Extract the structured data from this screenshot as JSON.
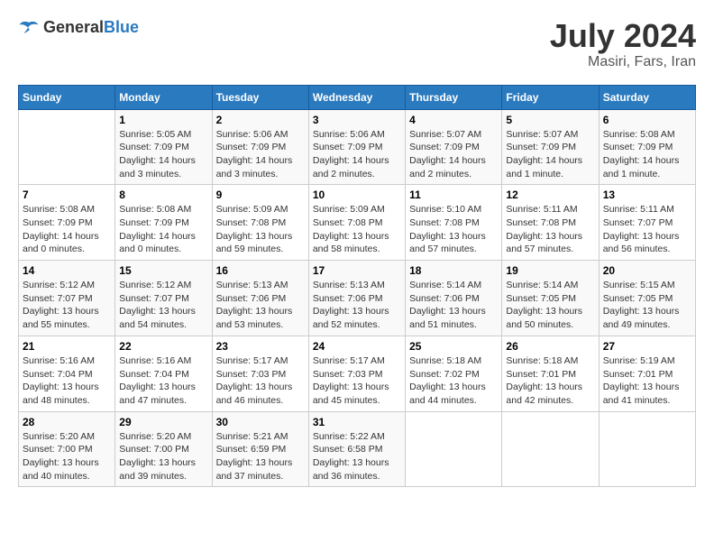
{
  "header": {
    "logo_general": "General",
    "logo_blue": "Blue",
    "main_title": "July 2024",
    "subtitle": "Masiri, Fars, Iran"
  },
  "calendar": {
    "days_of_week": [
      "Sunday",
      "Monday",
      "Tuesday",
      "Wednesday",
      "Thursday",
      "Friday",
      "Saturday"
    ],
    "weeks": [
      [
        {
          "date": "",
          "info": ""
        },
        {
          "date": "1",
          "info": "Sunrise: 5:05 AM\nSunset: 7:09 PM\nDaylight: 14 hours\nand 3 minutes."
        },
        {
          "date": "2",
          "info": "Sunrise: 5:06 AM\nSunset: 7:09 PM\nDaylight: 14 hours\nand 3 minutes."
        },
        {
          "date": "3",
          "info": "Sunrise: 5:06 AM\nSunset: 7:09 PM\nDaylight: 14 hours\nand 2 minutes."
        },
        {
          "date": "4",
          "info": "Sunrise: 5:07 AM\nSunset: 7:09 PM\nDaylight: 14 hours\nand 2 minutes."
        },
        {
          "date": "5",
          "info": "Sunrise: 5:07 AM\nSunset: 7:09 PM\nDaylight: 14 hours\nand 1 minute."
        },
        {
          "date": "6",
          "info": "Sunrise: 5:08 AM\nSunset: 7:09 PM\nDaylight: 14 hours\nand 1 minute."
        }
      ],
      [
        {
          "date": "7",
          "info": "Sunrise: 5:08 AM\nSunset: 7:09 PM\nDaylight: 14 hours\nand 0 minutes."
        },
        {
          "date": "8",
          "info": "Sunrise: 5:08 AM\nSunset: 7:09 PM\nDaylight: 14 hours\nand 0 minutes."
        },
        {
          "date": "9",
          "info": "Sunrise: 5:09 AM\nSunset: 7:08 PM\nDaylight: 13 hours\nand 59 minutes."
        },
        {
          "date": "10",
          "info": "Sunrise: 5:09 AM\nSunset: 7:08 PM\nDaylight: 13 hours\nand 58 minutes."
        },
        {
          "date": "11",
          "info": "Sunrise: 5:10 AM\nSunset: 7:08 PM\nDaylight: 13 hours\nand 57 minutes."
        },
        {
          "date": "12",
          "info": "Sunrise: 5:11 AM\nSunset: 7:08 PM\nDaylight: 13 hours\nand 57 minutes."
        },
        {
          "date": "13",
          "info": "Sunrise: 5:11 AM\nSunset: 7:07 PM\nDaylight: 13 hours\nand 56 minutes."
        }
      ],
      [
        {
          "date": "14",
          "info": "Sunrise: 5:12 AM\nSunset: 7:07 PM\nDaylight: 13 hours\nand 55 minutes."
        },
        {
          "date": "15",
          "info": "Sunrise: 5:12 AM\nSunset: 7:07 PM\nDaylight: 13 hours\nand 54 minutes."
        },
        {
          "date": "16",
          "info": "Sunrise: 5:13 AM\nSunset: 7:06 PM\nDaylight: 13 hours\nand 53 minutes."
        },
        {
          "date": "17",
          "info": "Sunrise: 5:13 AM\nSunset: 7:06 PM\nDaylight: 13 hours\nand 52 minutes."
        },
        {
          "date": "18",
          "info": "Sunrise: 5:14 AM\nSunset: 7:06 PM\nDaylight: 13 hours\nand 51 minutes."
        },
        {
          "date": "19",
          "info": "Sunrise: 5:14 AM\nSunset: 7:05 PM\nDaylight: 13 hours\nand 50 minutes."
        },
        {
          "date": "20",
          "info": "Sunrise: 5:15 AM\nSunset: 7:05 PM\nDaylight: 13 hours\nand 49 minutes."
        }
      ],
      [
        {
          "date": "21",
          "info": "Sunrise: 5:16 AM\nSunset: 7:04 PM\nDaylight: 13 hours\nand 48 minutes."
        },
        {
          "date": "22",
          "info": "Sunrise: 5:16 AM\nSunset: 7:04 PM\nDaylight: 13 hours\nand 47 minutes."
        },
        {
          "date": "23",
          "info": "Sunrise: 5:17 AM\nSunset: 7:03 PM\nDaylight: 13 hours\nand 46 minutes."
        },
        {
          "date": "24",
          "info": "Sunrise: 5:17 AM\nSunset: 7:03 PM\nDaylight: 13 hours\nand 45 minutes."
        },
        {
          "date": "25",
          "info": "Sunrise: 5:18 AM\nSunset: 7:02 PM\nDaylight: 13 hours\nand 44 minutes."
        },
        {
          "date": "26",
          "info": "Sunrise: 5:18 AM\nSunset: 7:01 PM\nDaylight: 13 hours\nand 42 minutes."
        },
        {
          "date": "27",
          "info": "Sunrise: 5:19 AM\nSunset: 7:01 PM\nDaylight: 13 hours\nand 41 minutes."
        }
      ],
      [
        {
          "date": "28",
          "info": "Sunrise: 5:20 AM\nSunset: 7:00 PM\nDaylight: 13 hours\nand 40 minutes."
        },
        {
          "date": "29",
          "info": "Sunrise: 5:20 AM\nSunset: 7:00 PM\nDaylight: 13 hours\nand 39 minutes."
        },
        {
          "date": "30",
          "info": "Sunrise: 5:21 AM\nSunset: 6:59 PM\nDaylight: 13 hours\nand 37 minutes."
        },
        {
          "date": "31",
          "info": "Sunrise: 5:22 AM\nSunset: 6:58 PM\nDaylight: 13 hours\nand 36 minutes."
        },
        {
          "date": "",
          "info": ""
        },
        {
          "date": "",
          "info": ""
        },
        {
          "date": "",
          "info": ""
        }
      ]
    ]
  }
}
